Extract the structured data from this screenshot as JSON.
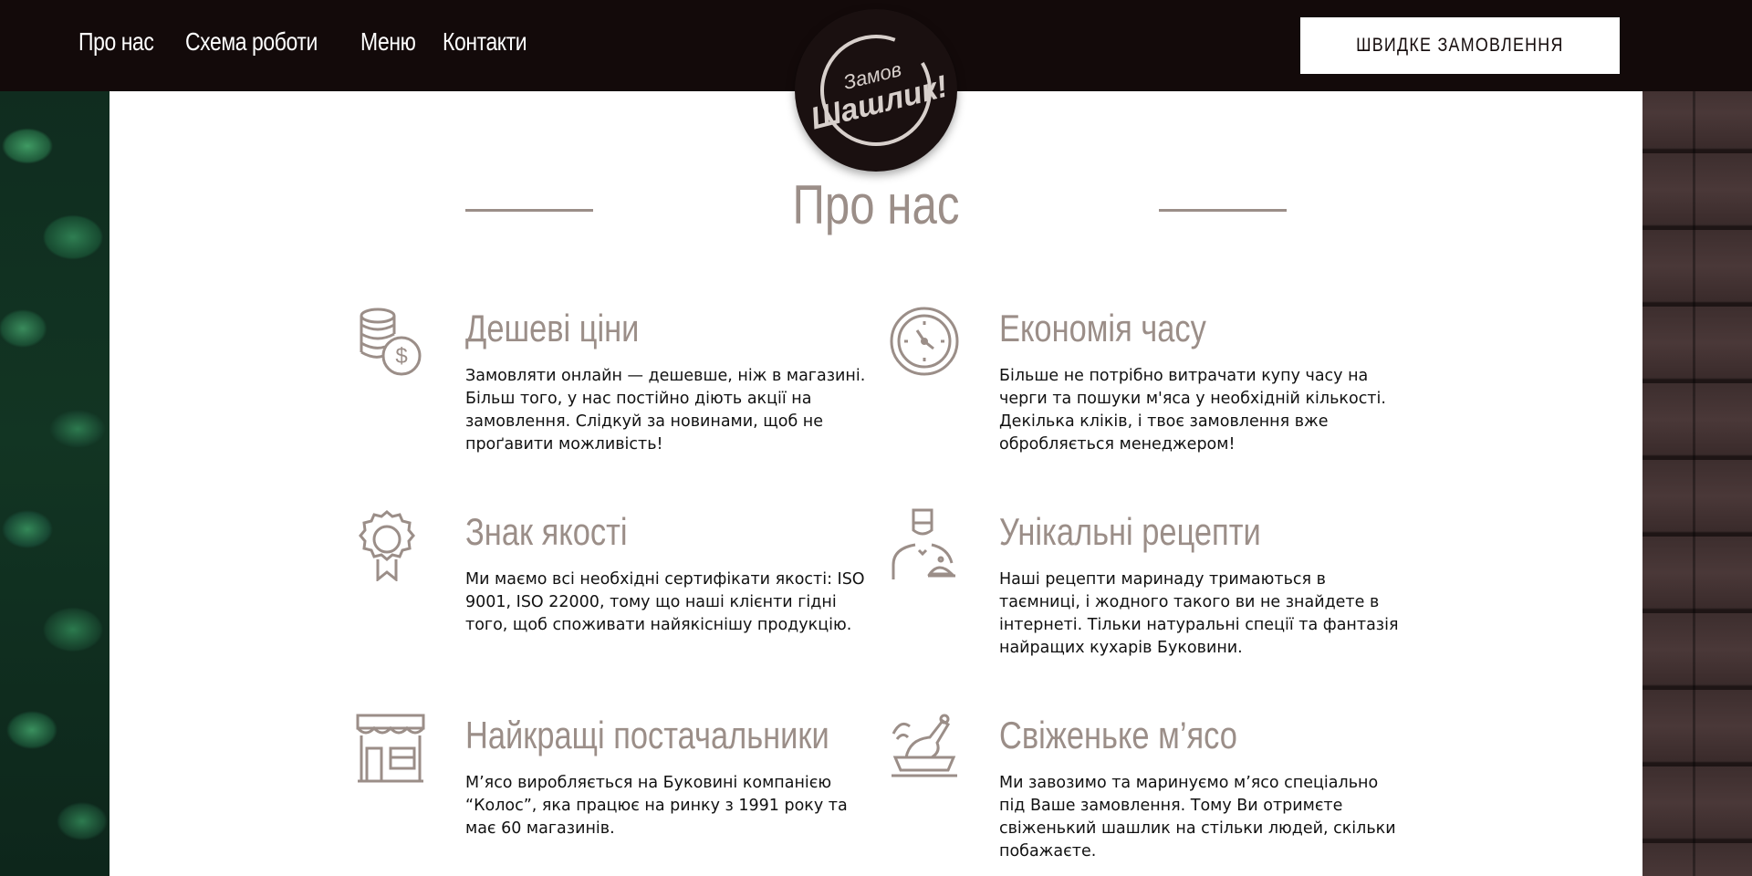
{
  "nav": {
    "items": [
      {
        "label": "Про нас"
      },
      {
        "label": "Схема роботи"
      },
      {
        "label": "Меню"
      },
      {
        "label": "Контакти"
      }
    ]
  },
  "header": {
    "order_button_label": "ШВИДКЕ ЗАМОВЛЕННЯ"
  },
  "logo": {
    "line1": "Замов",
    "line2": "Шашлик!"
  },
  "section": {
    "title": "Про нас"
  },
  "features": [
    {
      "icon": "coins-dollar-icon",
      "title": "Дешеві ціни",
      "text": "Замовляти онлайн — дешевше, ніж в магазині. Більш того, у нас постійно діють акції на замовлення. Слідкуй за новинами, щоб не проґавити можливість!"
    },
    {
      "icon": "clock-icon",
      "title": "Економія часу",
      "text": "Більше не потрібно витрачати купу часу на черги та пошуки м'яса у необхідній кількості. Декілька кліків, і твоє замовлення вже обробляється менеджером!"
    },
    {
      "icon": "quality-badge-icon",
      "title": "Знак якості",
      "text": "Ми маємо всі необхідні сертифікати якості: ISO 9001, ISO 22000, тому що наші клієнти гідні того, щоб споживати найякіснішу продукцію."
    },
    {
      "icon": "chef-icon",
      "title": "Унікальні рецепти",
      "text": "Наші рецепти маринаду тримаються в таємниці, і жодного такого ви не знайдете в інтернеті. Тільки натуральні спеції та фантазія найращих кухарів Буковини."
    },
    {
      "icon": "shop-icon",
      "title": "Найкращі постачальники",
      "text": "М’ясо виробляється на Буковині компанією “Колос”, яка працює на ринку з 1991 року та має 60 магазинів."
    },
    {
      "icon": "meat-dish-icon",
      "title": "Свіженьке м’ясо",
      "text": "Ми завозимо та маринуємо м’ясо спеціально під Ваше замовлення. Тому Ви отримєте свіженький шашлик на стільки людей, скільки побажаєте."
    }
  ],
  "colors": {
    "header_bg": "#130a0a",
    "accent": "#9b8e88",
    "panel_bg": "#ffffff"
  }
}
